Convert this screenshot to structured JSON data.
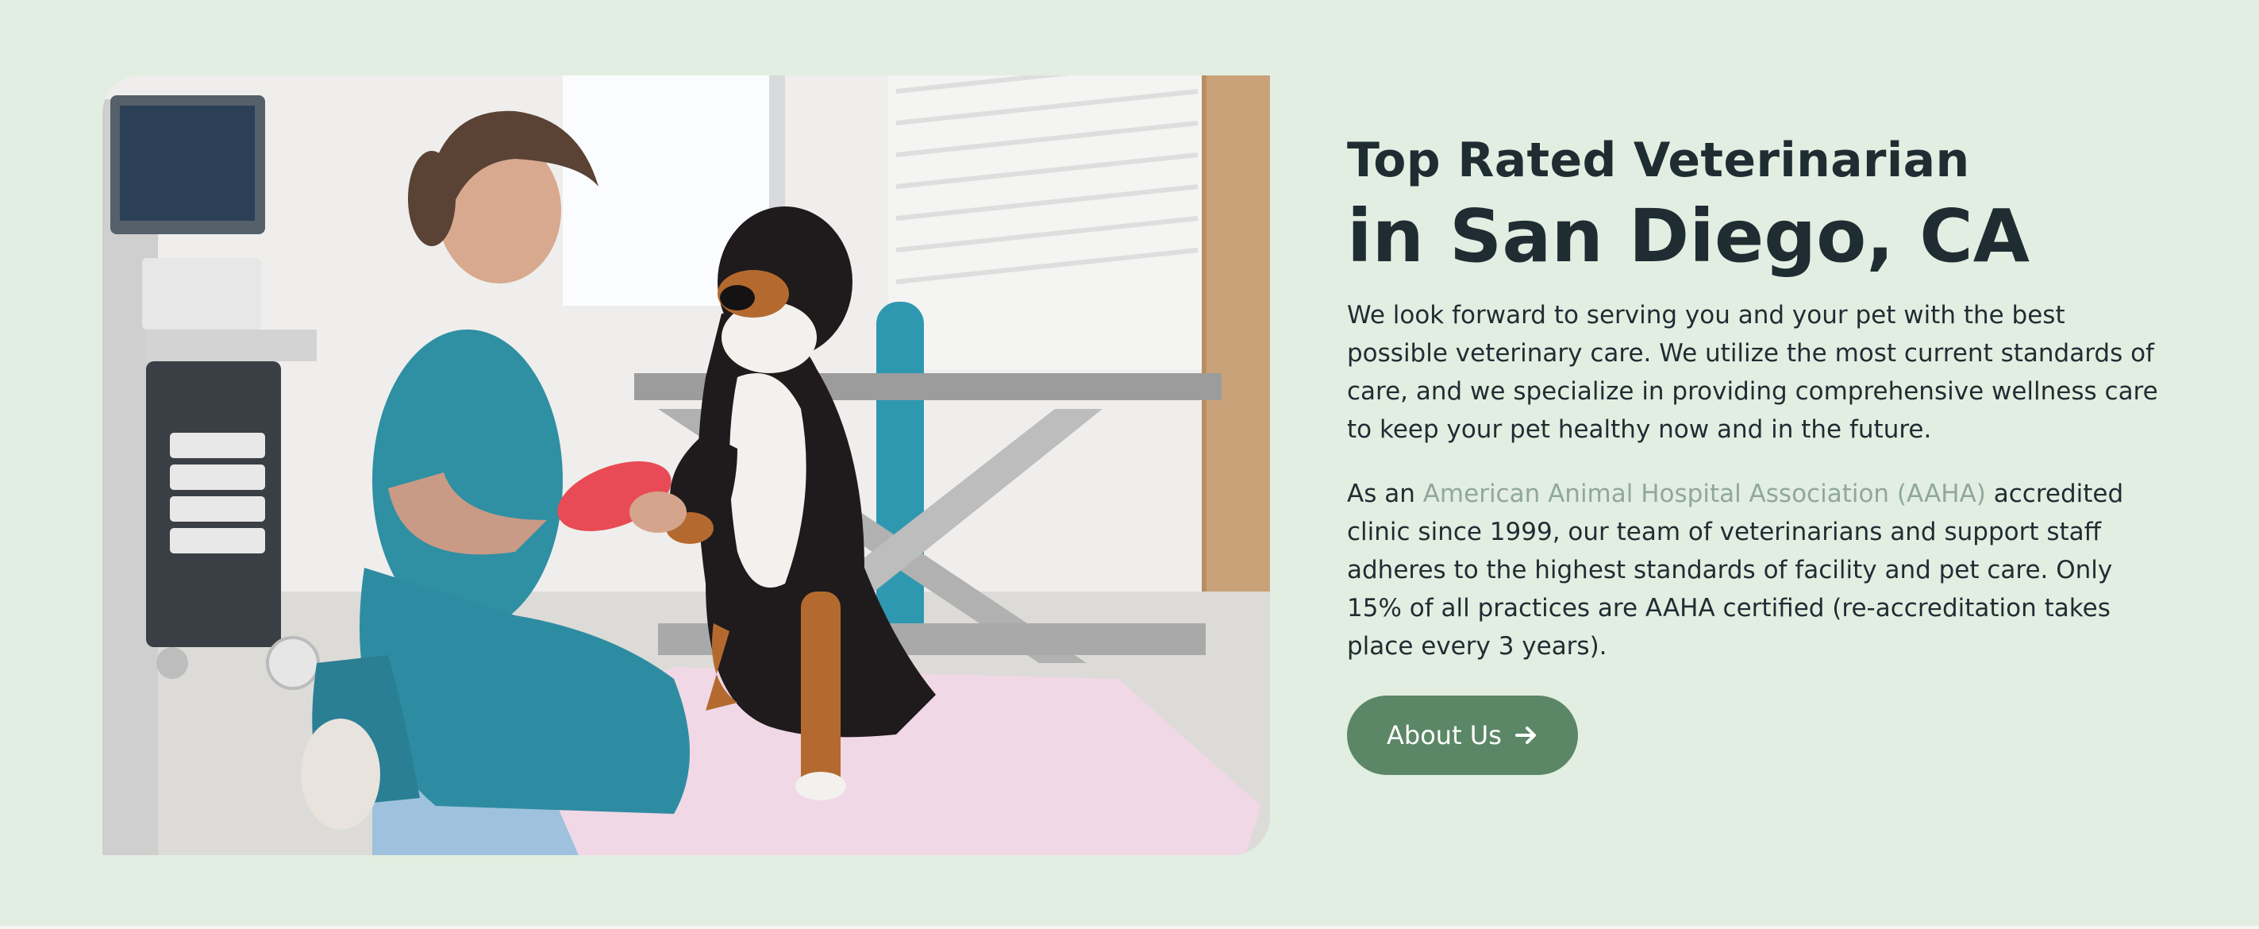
{
  "hero": {
    "image_alt": "Veterinarian kneeling and holding a dog's bandaged paw",
    "title_line1": "Top Rated Veterinarian",
    "title_line2": "in San Diego, CA",
    "paragraph1": "We look forward to serving you and your pet with the best possible veterinary care. We utilize the most current standards of care, and we specialize in providing comprehensive wellness care to keep your pet healthy now and in the future.",
    "paragraph2_prefix": "As an ",
    "paragraph2_link": "American Animal Hospital Association (AAHA)",
    "paragraph2_suffix": " accredited clinic since 1999, our team of veterinarians and support staff adheres to the highest standards of facility and pet care. Only 15% of all practices are AAHA certified (re-accreditation takes place every 3 years).",
    "button_label": "About Us",
    "button_icon": "arrow-right-icon"
  },
  "colors": {
    "background": "#e3eee2",
    "heading": "#1f2d33",
    "link": "#8fa89b",
    "button": "#5b8766"
  }
}
